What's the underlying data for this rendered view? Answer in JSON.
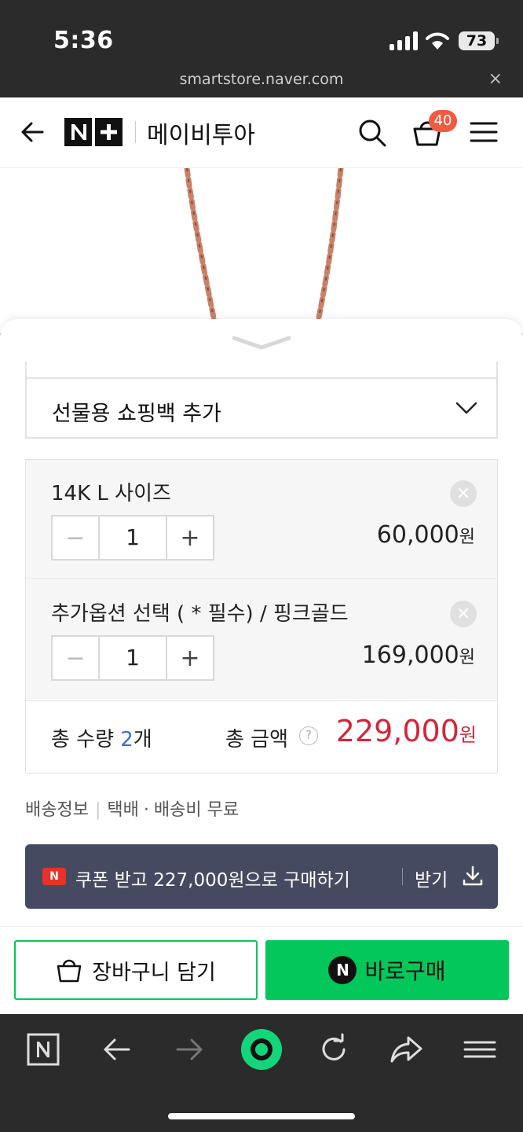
{
  "status_bar": {
    "time": "5:36",
    "battery": "73"
  },
  "url_bar": {
    "url": "smartstore.naver.com",
    "close": "×"
  },
  "header": {
    "logo": "N+",
    "store_name": "메이비투아",
    "cart_count": "40"
  },
  "sheet": {
    "gift_option": "선물용 쇼핑백 추가",
    "options": [
      {
        "name": "14K L 사이즈",
        "minus": "−",
        "plus": "+",
        "qty": "1",
        "price": "60,000",
        "currency": "원",
        "remove": "×"
      },
      {
        "name": "추가옵션 선택 ( * 필수) / 핑크골드",
        "minus": "−",
        "plus": "+",
        "qty": "1",
        "price": "169,000",
        "currency": "원",
        "remove": "×"
      }
    ],
    "total": {
      "qty_prefix": "총 수량 ",
      "qty": "2",
      "qty_suffix": "개",
      "amount_label": "총 금액",
      "help": "?",
      "amount": "229,000",
      "currency": "원"
    },
    "shipping": {
      "label": "배송정보",
      "method": "택배",
      "dot": "·",
      "fee": "배송비 무료"
    },
    "coupon": {
      "badge": "N",
      "text": "쿠폰 받고 227,000원으로 구매하기",
      "action": "받기"
    },
    "buttons": {
      "cart": "장바구니 담기",
      "buy_badge": "N",
      "buy": "바로구매"
    }
  },
  "colors": {
    "accent_green": "#03c75a",
    "price_red": "#d3263a",
    "badge_red": "#f15a40",
    "coupon_bg": "#464a61"
  }
}
